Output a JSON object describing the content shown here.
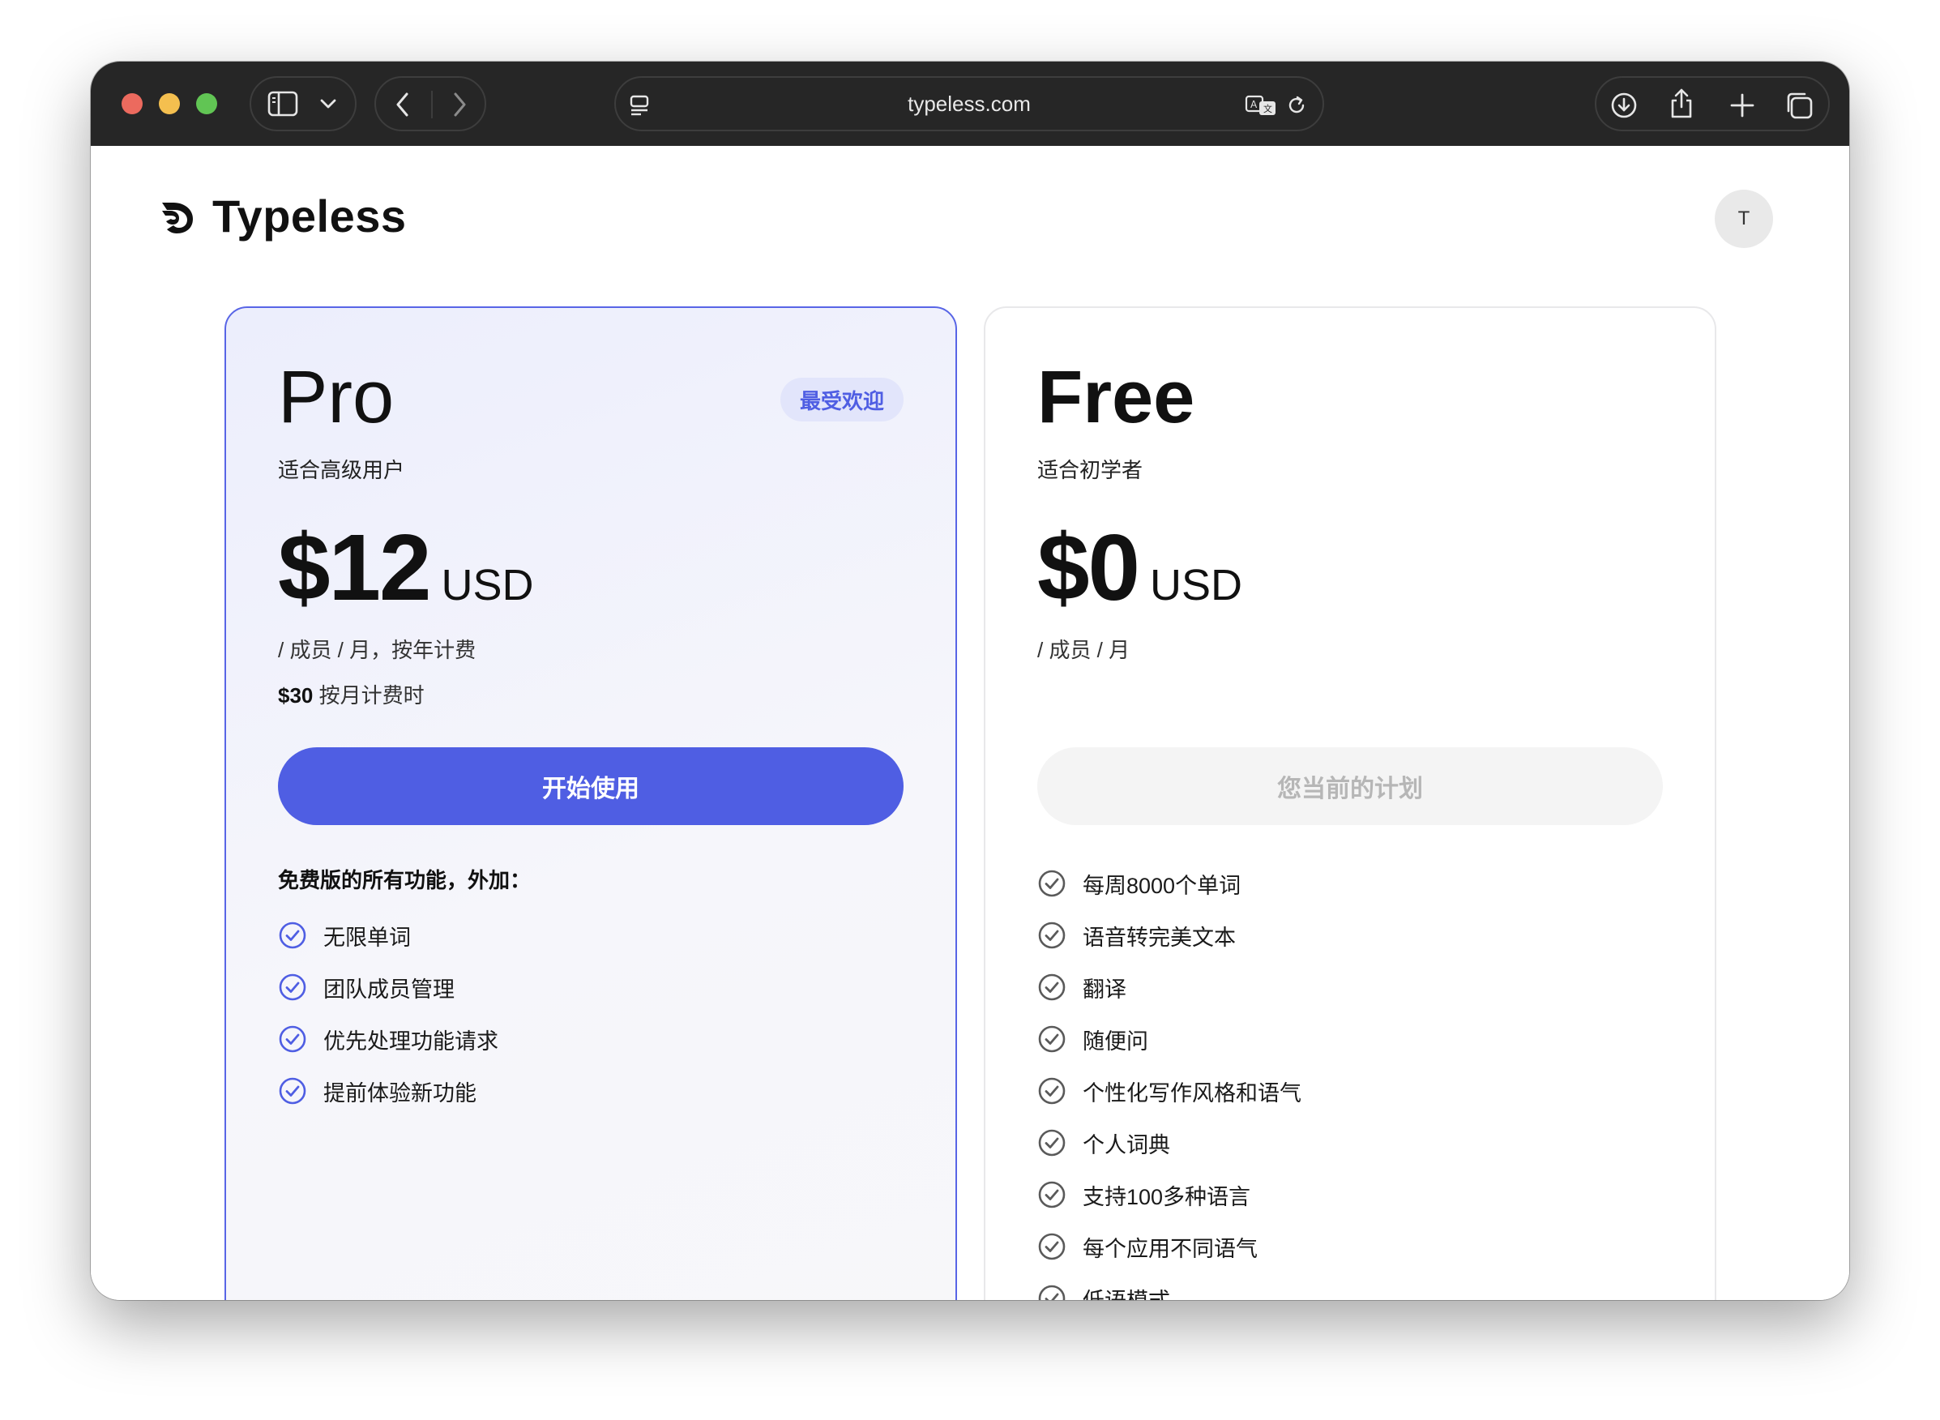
{
  "browser": {
    "url": "typeless.com"
  },
  "header": {
    "logo_text": "Typeless",
    "avatar_initial": "T"
  },
  "colors": {
    "accent": "#4f5ee3",
    "badge_bg": "#e2e5fb",
    "toolbar_bg": "#262626"
  },
  "plans": {
    "pro": {
      "name": "Pro",
      "badge": "最受欢迎",
      "subtitle": "适合高级用户",
      "price": "$12",
      "currency": "USD",
      "period": "/ 成员 / 月，按年计费",
      "monthly_price": "$30",
      "monthly_note": "按月计费时",
      "cta": "开始使用",
      "features_heading": "免费版的所有功能，外加：",
      "features": [
        "无限单词",
        "团队成员管理",
        "优先处理功能请求",
        "提前体验新功能"
      ]
    },
    "free": {
      "name": "Free",
      "subtitle": "适合初学者",
      "price": "$0",
      "currency": "USD",
      "period": "/ 成员 / 月",
      "cta": "您当前的计划",
      "features": [
        "每周8000个单词",
        "语音转完美文本",
        "翻译",
        "随便问",
        "个性化写作风格和语气",
        "个人词典",
        "支持100多种语言",
        "每个应用不同语气",
        "低语模式"
      ]
    }
  }
}
